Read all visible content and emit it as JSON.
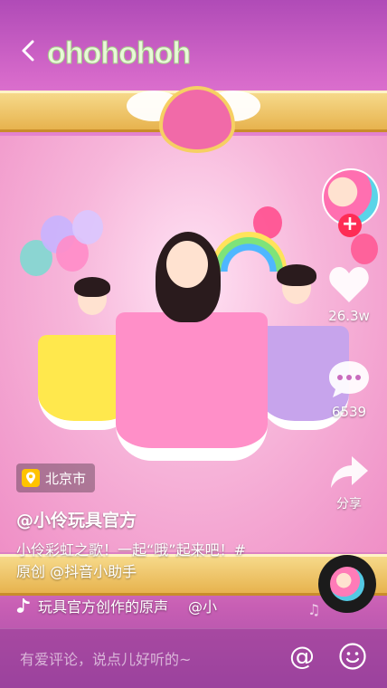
{
  "top_bar": {
    "back_icon": "chevron-left-icon",
    "song_tag": "ohohohoh"
  },
  "right_rail": {
    "follow_icon": "plus-icon",
    "like_icon": "heart-icon",
    "like_count": "26.3w",
    "comment_icon": "comment-bubble-icon",
    "comment_count": "6539",
    "share_icon": "share-arrow-icon",
    "share_label": "分享"
  },
  "video_info": {
    "location_icon": "location-pin-icon",
    "location": "北京市",
    "author": "@小伶玩具官方",
    "caption_line1": "小伶彩虹之歌！一起“哦”起来吧！#",
    "caption_line2": "原创 @抖音小助手",
    "music_icon": "music-note-icon",
    "music_text": "玩具官方创作的原声",
    "music_text_tail": "@小"
  },
  "comment_bar": {
    "placeholder": "有爱评论，说点儿好听的~",
    "at_icon": "at-sign-icon",
    "emoji_icon": "smiley-icon"
  },
  "colors": {
    "accent_red": "#fe2c55",
    "frame_gold": "#e7b34e",
    "background_pink": "#f3a3d8"
  }
}
